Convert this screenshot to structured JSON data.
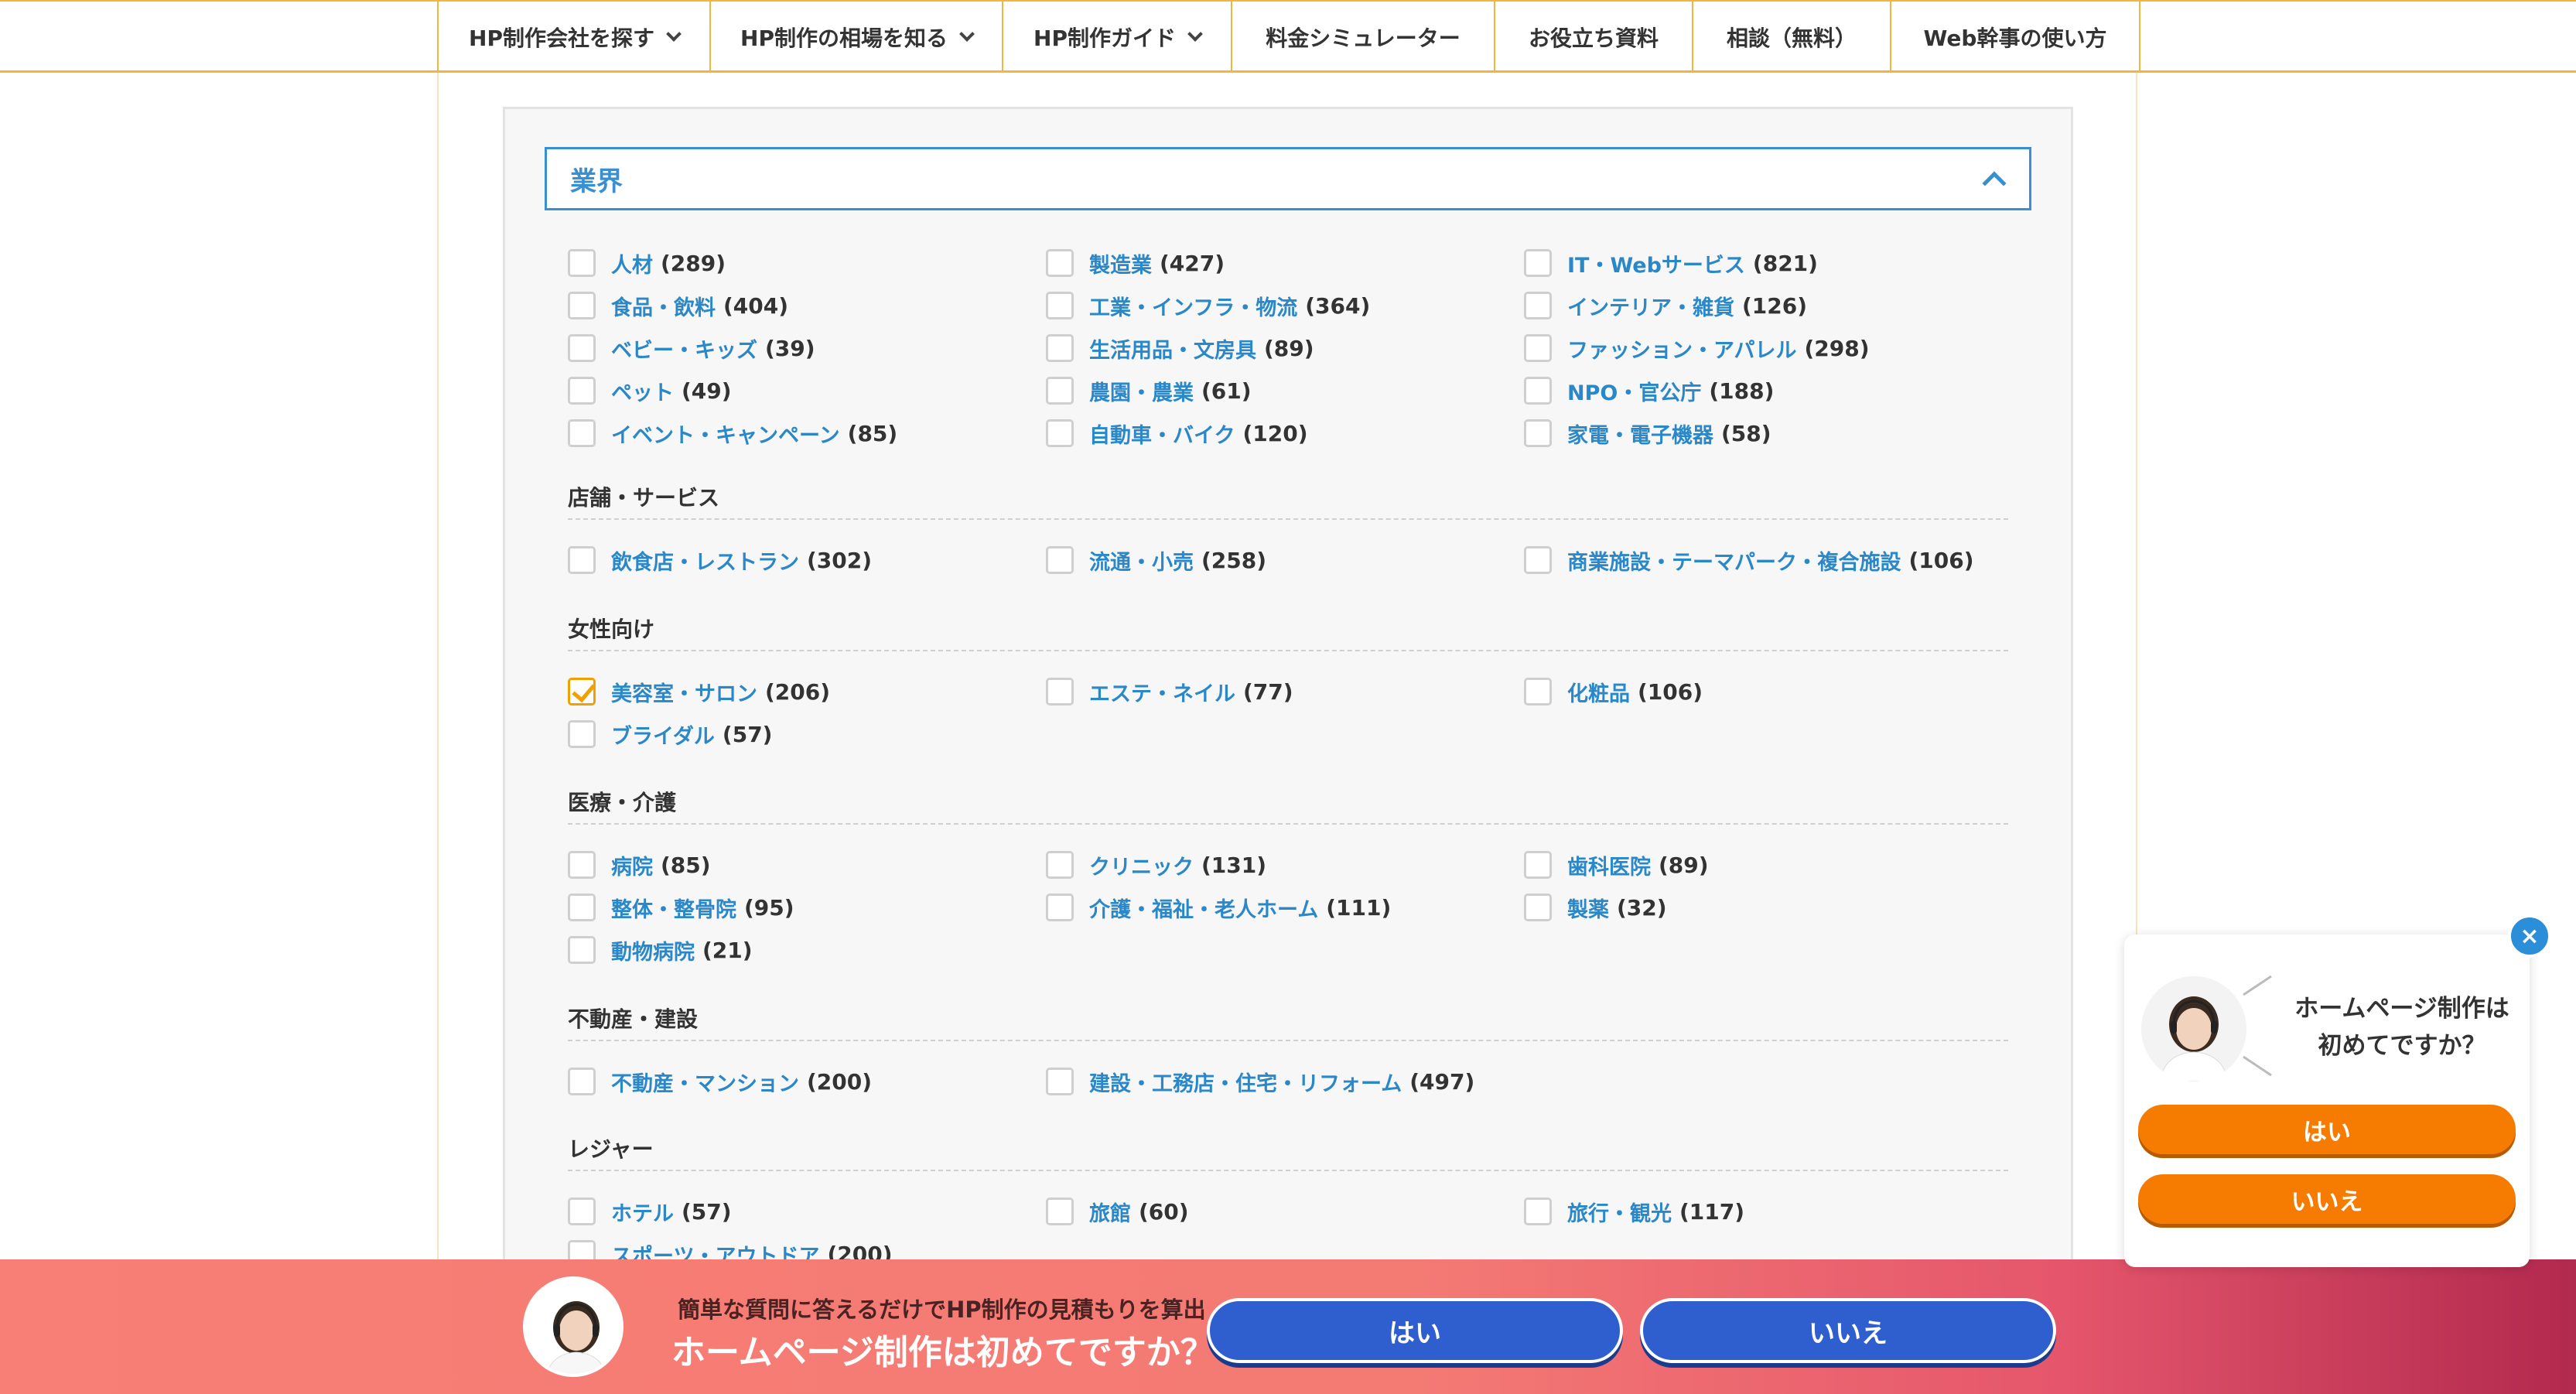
{
  "nav": {
    "items": [
      {
        "label": "HP制作会社を探す",
        "has_dropdown": true
      },
      {
        "label": "HP制作の相場を知る",
        "has_dropdown": true
      },
      {
        "label": "HP制作ガイド",
        "has_dropdown": true
      },
      {
        "label": "料金シミュレーター",
        "has_dropdown": false
      },
      {
        "label": "お役立ち資料",
        "has_dropdown": false
      },
      {
        "label": "相談（無料）",
        "has_dropdown": false
      },
      {
        "label": "Web幹事の使い方",
        "has_dropdown": false
      }
    ]
  },
  "filter": {
    "title": "業界",
    "general": [
      {
        "label": "人材",
        "count": "(289)",
        "checked": false
      },
      {
        "label": "製造業",
        "count": "(427)",
        "checked": false
      },
      {
        "label": "IT・Webサービス",
        "count": "(821)",
        "checked": false
      },
      {
        "label": "食品・飲料",
        "count": "(404)",
        "checked": false
      },
      {
        "label": "工業・インフラ・物流",
        "count": "(364)",
        "checked": false
      },
      {
        "label": "インテリア・雑貨",
        "count": "(126)",
        "checked": false
      },
      {
        "label": "ベビー・キッズ",
        "count": "(39)",
        "checked": false
      },
      {
        "label": "生活用品・文房具",
        "count": "(89)",
        "checked": false
      },
      {
        "label": "ファッション・アパレル",
        "count": "(298)",
        "checked": false
      },
      {
        "label": "ペット",
        "count": "(49)",
        "checked": false
      },
      {
        "label": "農園・農業",
        "count": "(61)",
        "checked": false
      },
      {
        "label": "NPO・官公庁",
        "count": "(188)",
        "checked": false
      },
      {
        "label": "イベント・キャンペーン",
        "count": "(85)",
        "checked": false
      },
      {
        "label": "自動車・バイク",
        "count": "(120)",
        "checked": false
      },
      {
        "label": "家電・電子機器",
        "count": "(58)",
        "checked": false
      }
    ],
    "sections": [
      {
        "title": "店舗・サービス",
        "items": [
          {
            "label": "飲食店・レストラン",
            "count": "(302)",
            "checked": false
          },
          {
            "label": "流通・小売",
            "count": "(258)",
            "checked": false
          },
          {
            "label": "商業施設・テーマパーク・複合施設",
            "count": "(106)",
            "checked": false
          }
        ]
      },
      {
        "title": "女性向け",
        "items": [
          {
            "label": "美容室・サロン",
            "count": "(206)",
            "checked": true
          },
          {
            "label": "エステ・ネイル",
            "count": "(77)",
            "checked": false
          },
          {
            "label": "化粧品",
            "count": "(106)",
            "checked": false
          },
          {
            "label": "ブライダル",
            "count": "(57)",
            "checked": false
          }
        ]
      },
      {
        "title": "医療・介護",
        "items": [
          {
            "label": "病院",
            "count": "(85)",
            "checked": false
          },
          {
            "label": "クリニック",
            "count": "(131)",
            "checked": false
          },
          {
            "label": "歯科医院",
            "count": "(89)",
            "checked": false
          },
          {
            "label": "整体・整骨院",
            "count": "(95)",
            "checked": false
          },
          {
            "label": "介護・福祉・老人ホーム",
            "count": "(111)",
            "checked": false
          },
          {
            "label": "製薬",
            "count": "(32)",
            "checked": false
          },
          {
            "label": "動物病院",
            "count": "(21)",
            "checked": false
          }
        ]
      },
      {
        "title": "不動産・建設",
        "items": [
          {
            "label": "不動産・マンション",
            "count": "(200)",
            "checked": false
          },
          {
            "label": "建設・工務店・住宅・リフォーム",
            "count": "(497)",
            "checked": false
          }
        ]
      },
      {
        "title": "レジャー",
        "items": [
          {
            "label": "ホテル",
            "count": "(57)",
            "checked": false
          },
          {
            "label": "旅館",
            "count": "(60)",
            "checked": false
          },
          {
            "label": "旅行・観光",
            "count": "(117)",
            "checked": false
          },
          {
            "label": "スポーツ・アウトドア",
            "count": "(200)",
            "checked": false
          }
        ]
      }
    ]
  },
  "banner": {
    "subtitle": "簡単な質問に答えるだけでHP制作の見積もりを算出",
    "title": "ホームページ制作は初めてですか？",
    "yes_label": "はい",
    "no_label": "いいえ"
  },
  "chat": {
    "close_label": "×",
    "question_line1": "ホームページ制作は",
    "question_line2": "初めてですか？",
    "yes_label": "はい",
    "no_label": "いいえ"
  },
  "colors": {
    "accent_orange": "#f0b640",
    "link_blue": "#2a87c8",
    "banner_button": "#2f5fcf",
    "chat_button": "#f57c00"
  }
}
